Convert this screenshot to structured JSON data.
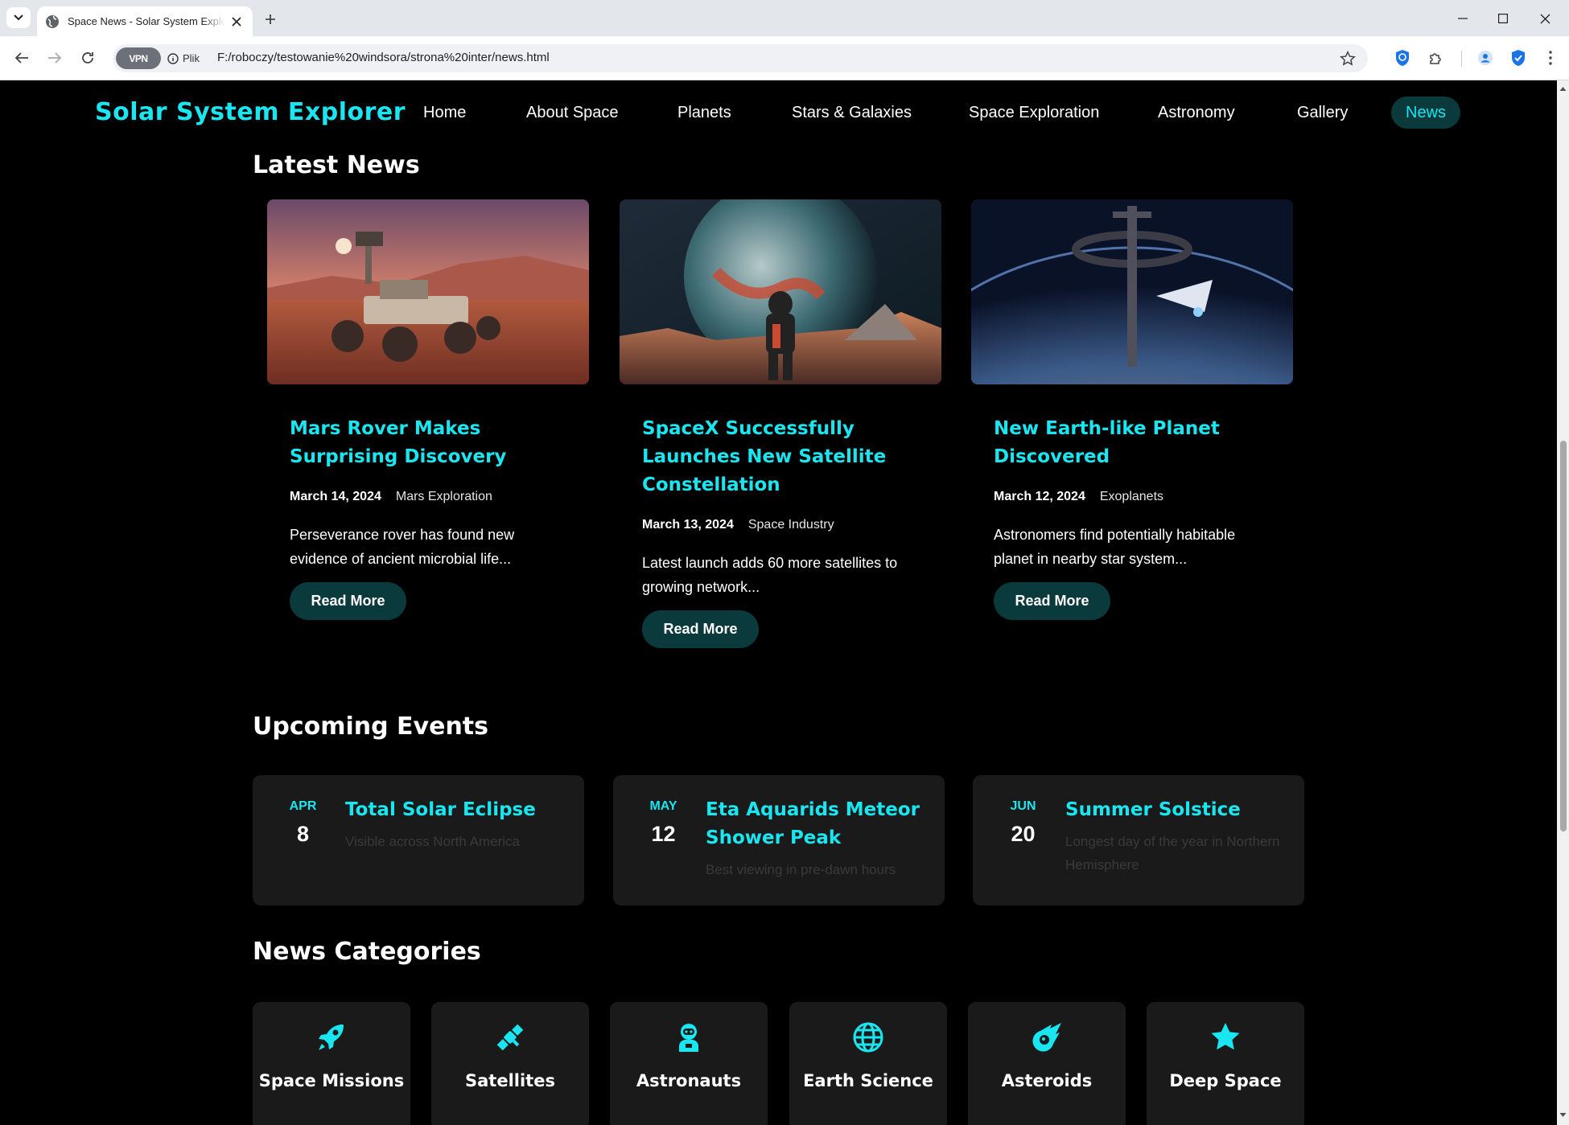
{
  "browser": {
    "tab_title": "Space News - Solar System Explorer",
    "vpn_label": "VPN",
    "site_info_label": "Plik",
    "url": "F:/roboczy/testowanie%20windsora/strona%20inter/news.html"
  },
  "site": {
    "logo": "Solar System Explorer",
    "nav": [
      {
        "label": "Home",
        "active": false
      },
      {
        "label": "About Space",
        "active": false
      },
      {
        "label": "Planets",
        "active": false
      },
      {
        "label": "Stars & Galaxies",
        "active": false
      },
      {
        "label": "Space Exploration",
        "active": false
      },
      {
        "label": "Astronomy",
        "active": false
      },
      {
        "label": "Gallery",
        "active": false
      },
      {
        "label": "News",
        "active": true
      }
    ]
  },
  "latest_news": {
    "title": "Latest News",
    "articles": [
      {
        "title": "Mars Rover Makes Surprising Discovery",
        "date": "March 14, 2024",
        "category": "Mars Exploration",
        "excerpt": "Perseverance rover has found new evidence of ancient microbial life...",
        "button": "Read More"
      },
      {
        "title": "SpaceX Successfully Launches New Satellite Constellation",
        "date": "March 13, 2024",
        "category": "Space Industry",
        "excerpt": "Latest launch adds 60 more satellites to growing network...",
        "button": "Read More"
      },
      {
        "title": "New Earth-like Planet Discovered",
        "date": "March 12, 2024",
        "category": "Exoplanets",
        "excerpt": "Astronomers find potentially habitable planet in nearby star system...",
        "button": "Read More"
      }
    ]
  },
  "events": {
    "title": "Upcoming Events",
    "items": [
      {
        "month": "APR",
        "day": "8",
        "title": "Total Solar Eclipse",
        "description": "Visible across North America"
      },
      {
        "month": "MAY",
        "day": "12",
        "title": "Eta Aquarids Meteor Shower Peak",
        "description": "Best viewing in pre-dawn hours"
      },
      {
        "month": "JUN",
        "day": "20",
        "title": "Summer Solstice",
        "description": "Longest day of the year in Northern Hemisphere"
      }
    ]
  },
  "categories": {
    "title": "News Categories",
    "items": [
      {
        "label": "Space Missions",
        "icon": "rocket-icon"
      },
      {
        "label": "Satellites",
        "icon": "satellite-icon"
      },
      {
        "label": "Astronauts",
        "icon": "astronaut-icon"
      },
      {
        "label": "Earth Science",
        "icon": "globe-icon"
      },
      {
        "label": "Asteroids",
        "icon": "meteor-icon"
      },
      {
        "label": "Deep Space",
        "icon": "star-icon"
      }
    ]
  },
  "colors": {
    "accent": "#19e6f0",
    "button_bg": "#0b3a3d",
    "card_bg": "#1a1a1a",
    "page_bg": "#000000"
  }
}
